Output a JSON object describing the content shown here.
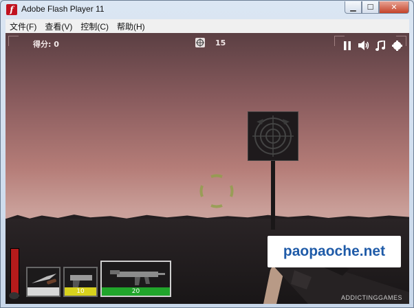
{
  "window": {
    "title": "Adobe Flash Player 11"
  },
  "menu": {
    "items": [
      "文件(F)",
      "查看(V)",
      "控制(C)",
      "帮助(H)"
    ]
  },
  "hud": {
    "score_label": "得分:",
    "score_value": "0",
    "targets_count": "15",
    "controls": [
      "pause-icon",
      "sound-icon",
      "music-icon",
      "quality-icon"
    ]
  },
  "weapons": [
    {
      "name": "knife",
      "ammo": "",
      "ammo_color": "#d8d8d8",
      "selected": false
    },
    {
      "name": "pistol",
      "ammo": "10",
      "ammo_color": "#d8d21d",
      "selected": false
    },
    {
      "name": "smg",
      "ammo": "20",
      "ammo_color": "#21a52b",
      "selected": true
    }
  ],
  "health": {
    "level": 1.0,
    "color": "#b51b1b"
  },
  "watermark": {
    "text": "paopaoche.net"
  },
  "publisher": {
    "text": "ADDICTINGGAMES"
  }
}
